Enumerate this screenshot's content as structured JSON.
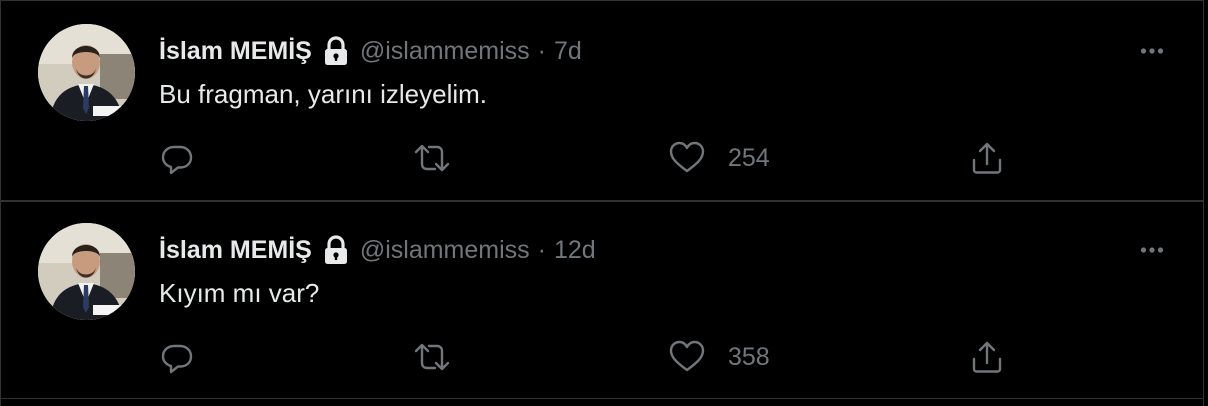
{
  "tweets": [
    {
      "name": "İslam MEMİŞ",
      "handle": "@islammemiss",
      "separator": "·",
      "time": "7d",
      "text": "Bu fragman, yarını izleyelim.",
      "likes": "254",
      "icons": {
        "lock": "lock-icon",
        "more": "more-icon",
        "reply": "reply-icon",
        "retweet": "retweet-icon",
        "like": "heart-icon",
        "share": "share-icon"
      }
    },
    {
      "name": "İslam MEMİŞ",
      "handle": "@islammemiss",
      "separator": "·",
      "time": "12d",
      "text": "Kıyım mı var?",
      "likes": "358",
      "icons": {
        "lock": "lock-icon",
        "more": "more-icon",
        "reply": "reply-icon",
        "retweet": "retweet-icon",
        "like": "heart-icon",
        "share": "share-icon"
      }
    }
  ],
  "colors": {
    "background": "#000000",
    "primary_text": "#e7e9ea",
    "secondary_text": "#71767b",
    "border": "#2f3336"
  }
}
